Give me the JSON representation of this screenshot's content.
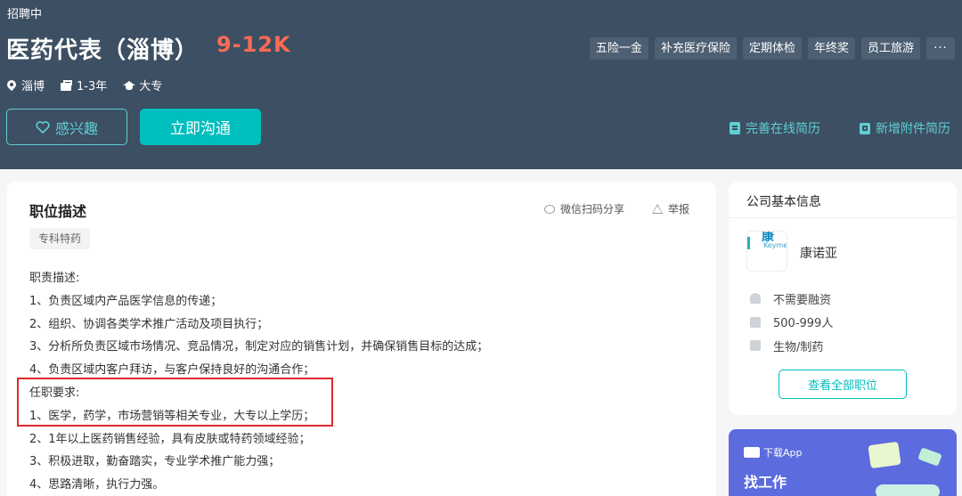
{
  "header": {
    "status": "招聘中",
    "job_title": "医药代表（淄博）",
    "salary": "9-12K",
    "meta": {
      "city": "淄博",
      "experience": "1-3年",
      "education": "大专"
    },
    "benefits": [
      "五险一金",
      "补充医疗保险",
      "定期体检",
      "年终奖",
      "员工旅游",
      "···"
    ],
    "interest_label": "感兴趣",
    "chat_label": "立即沟通",
    "resume_link": "完善在线简历",
    "attach_link": "新增附件简历"
  },
  "job": {
    "section_title": "职位描述",
    "share_label": "微信扫码分享",
    "report_label": "举报",
    "skill_tag": "专科特药",
    "description_lines": [
      "职责描述:",
      "1、负责区域内产品医学信息的传递；",
      "2、组织、协调各类学术推广活动及项目执行；",
      "3、分析所负责区域市场情况、竞品情况，制定对应的销售计划，并确保销售目标的达成；",
      "4、负责区域内客户拜访，与客户保持良好的沟通合作；",
      "任职要求:",
      "1、医学，药学，市场营销等相关专业，大专以上学历；",
      "2、1年以上医药销售经验，具有皮肤或特药领域经验；",
      "3、积极进取，勤奋踏实，专业学术推广能力强；",
      "4、思路清晰，执行力强。"
    ]
  },
  "company": {
    "section_title": "公司基本信息",
    "logo_text": "Keyme",
    "logo_mark": "康",
    "name": "康诺亚",
    "financing": "不需要融资",
    "size": "500-999人",
    "industry": "生物/制药",
    "all_jobs_label": "查看全部职位"
  },
  "app_promo": {
    "download_label": "下载App",
    "title": "找工作"
  },
  "colors": {
    "header_bg": "#3d4f63",
    "accent": "#00bebd",
    "salary": "#fb6b54",
    "highlight": "#e0282c"
  }
}
